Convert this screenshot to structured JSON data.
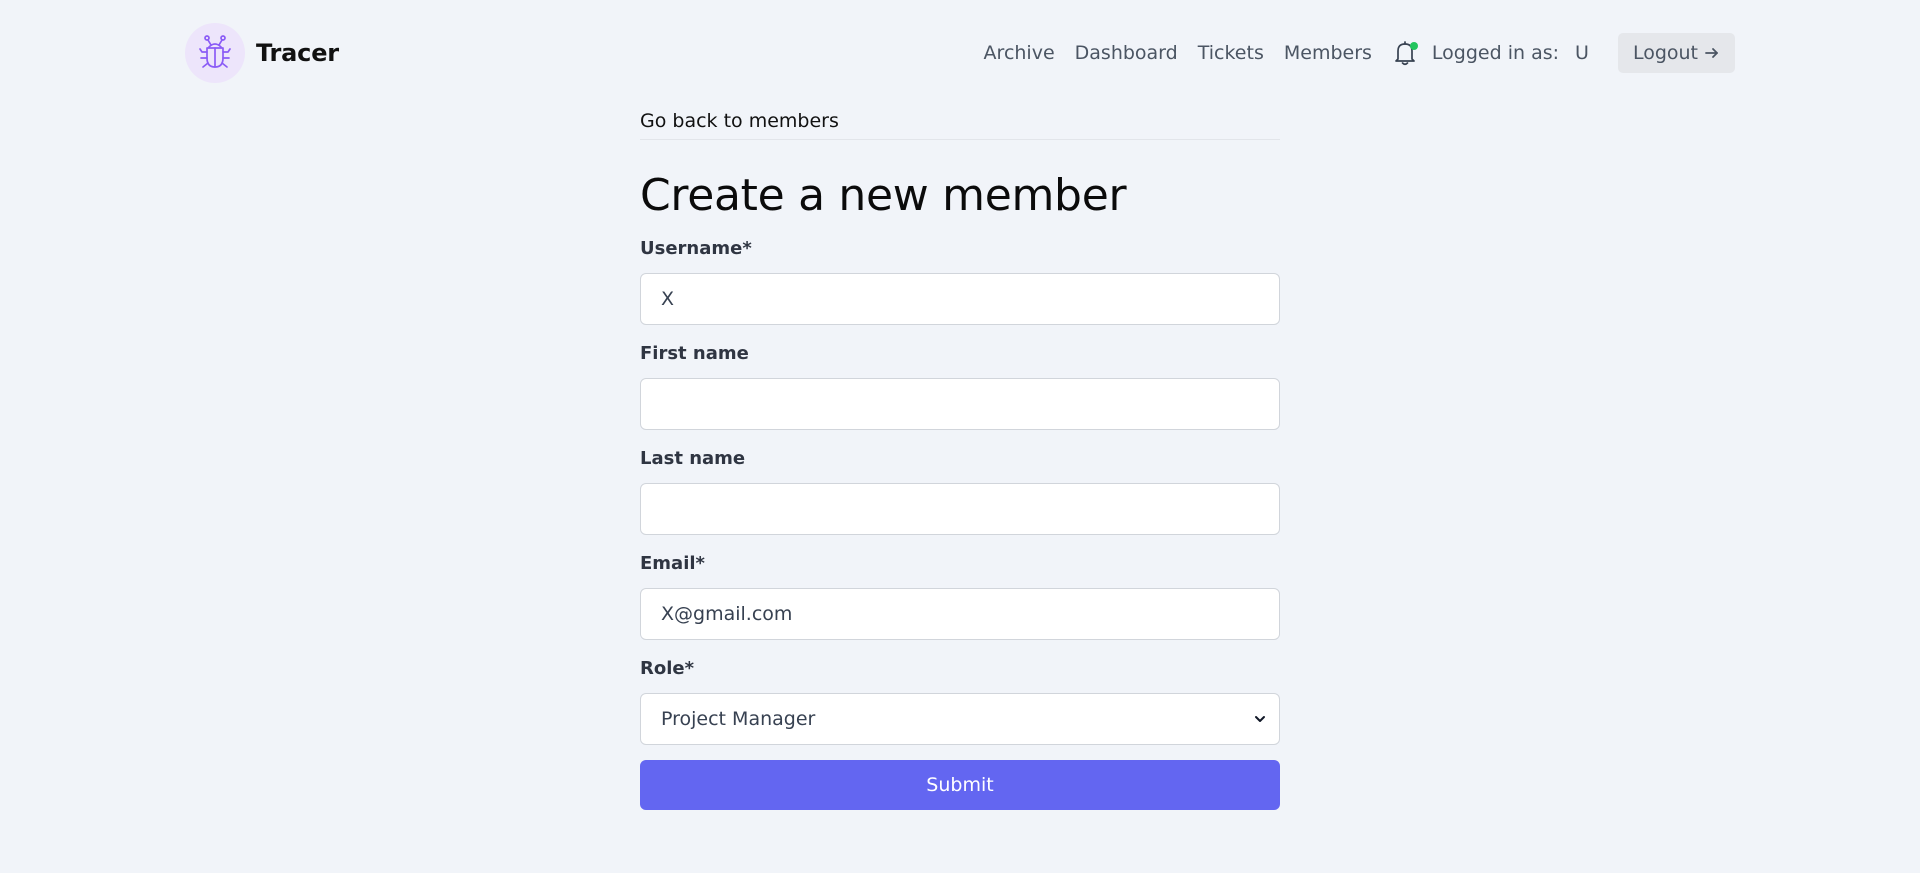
{
  "app": {
    "name": "Tracer",
    "logo_icon": "bug-icon"
  },
  "nav": {
    "items": [
      {
        "label": "Archive"
      },
      {
        "label": "Dashboard"
      },
      {
        "label": "Tickets"
      },
      {
        "label": "Members"
      }
    ],
    "notification_icon": "bell-icon",
    "notification_dot_color": "#22c55e",
    "logged_in_label": "Logged in as:",
    "logged_in_user": "U",
    "logout_label": "Logout",
    "logout_icon": "arrow-right-icon"
  },
  "form": {
    "back_link": "Go back to members",
    "title": "Create a new member",
    "fields": {
      "username": {
        "label": "Username*",
        "value": "X"
      },
      "first_name": {
        "label": "First name",
        "value": ""
      },
      "last_name": {
        "label": "Last name",
        "value": ""
      },
      "email": {
        "label": "Email*",
        "value": "X@gmail.com"
      },
      "role": {
        "label": "Role*",
        "selected": "Project Manager"
      }
    },
    "submit_label": "Submit"
  },
  "colors": {
    "accent": "#6366f1",
    "background": "#f1f4f9",
    "logo_bg": "#ede5fb"
  }
}
